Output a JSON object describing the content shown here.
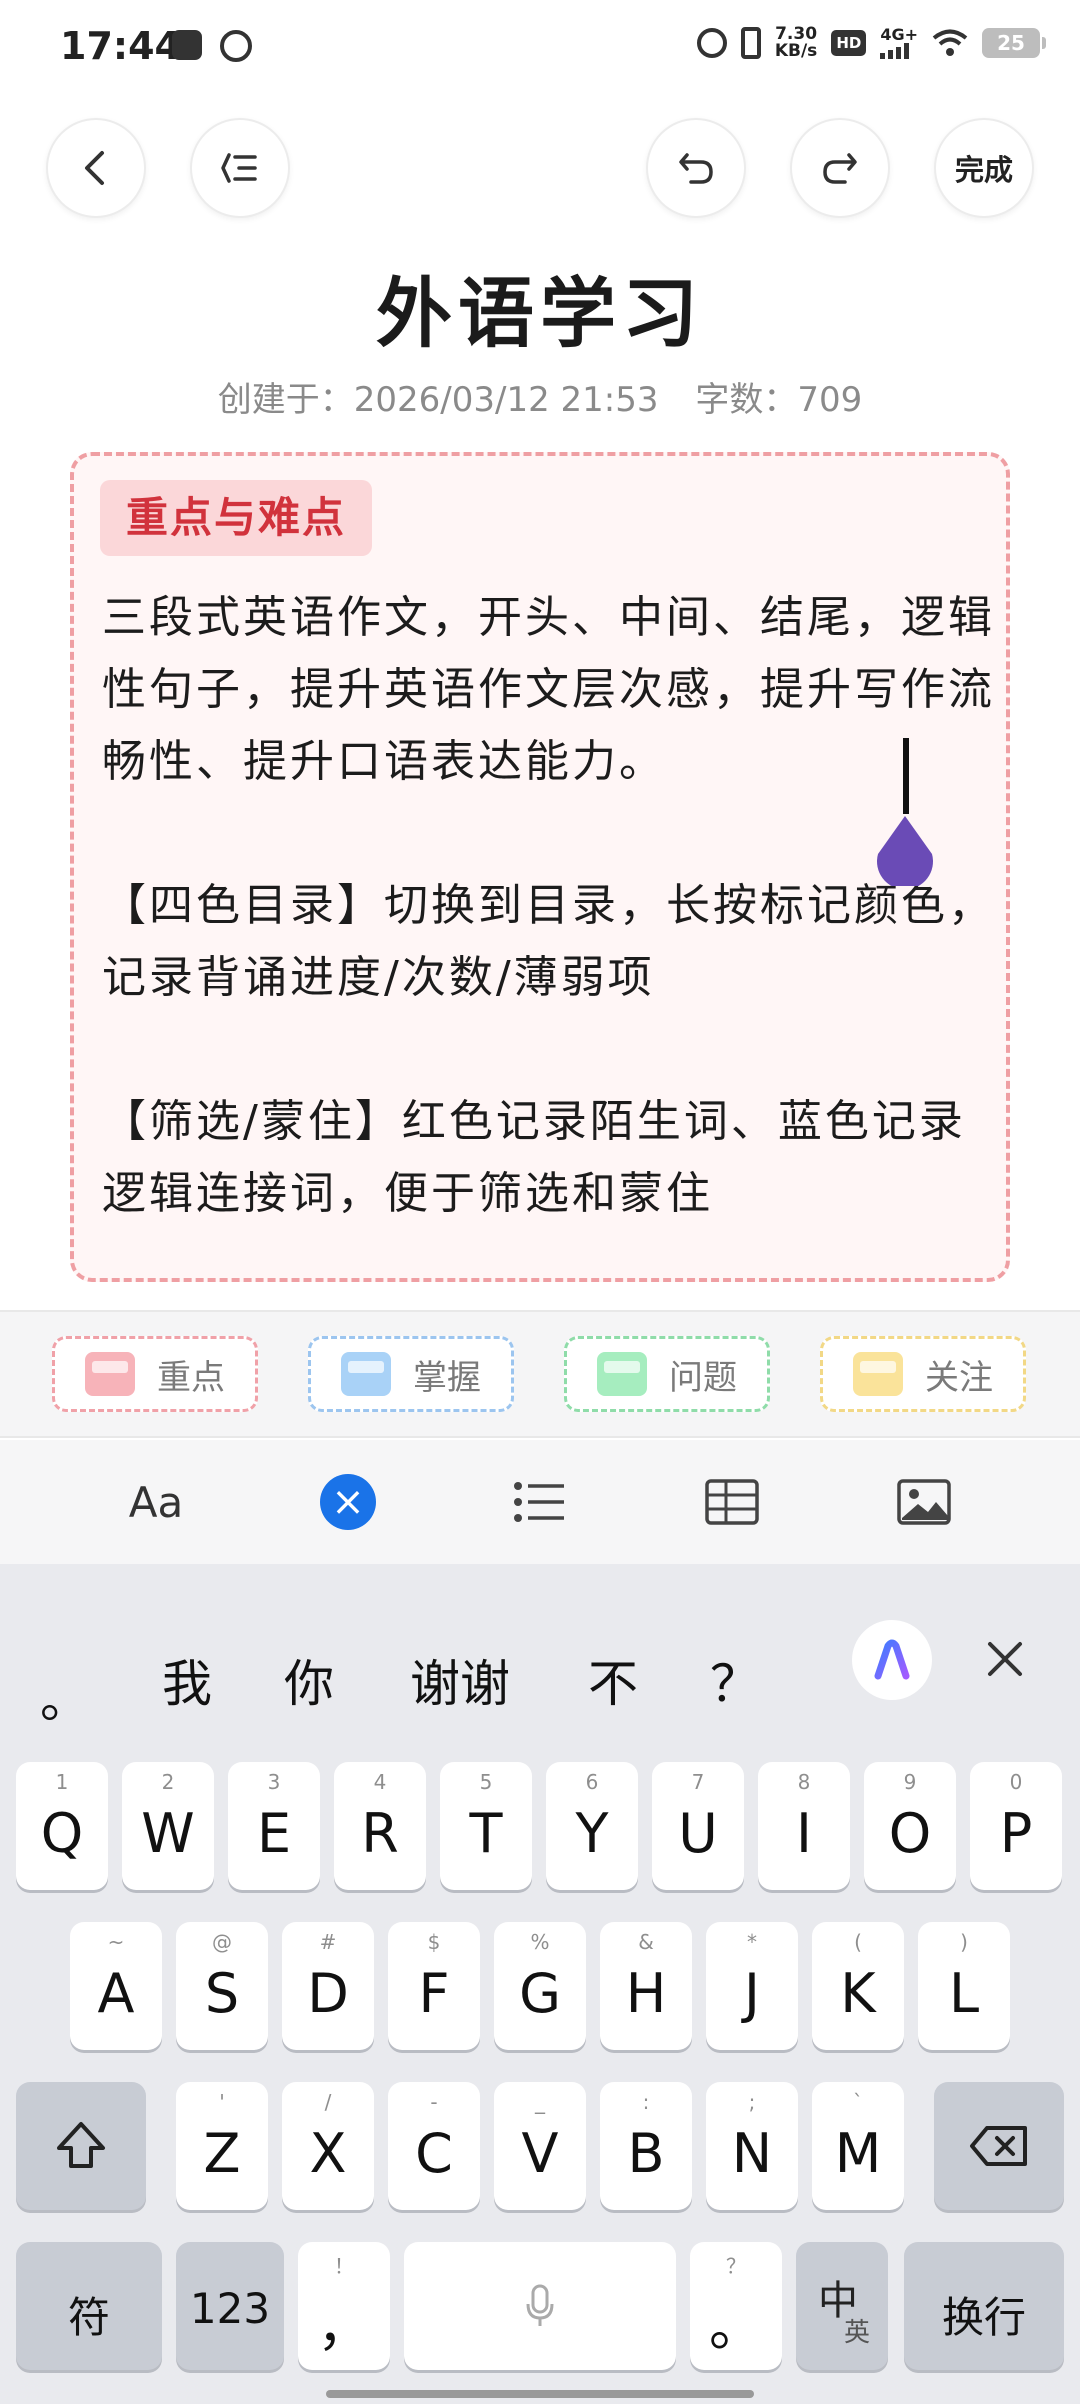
{
  "status_bar": {
    "time": "17:44",
    "net_speed_value": "7.30",
    "net_speed_unit": "KB/s",
    "hd_badge": "HD",
    "network_type": "4G+",
    "battery_level": "25"
  },
  "toolbar": {
    "done_label": "完成"
  },
  "note": {
    "title": "外语学习",
    "created_label": "创建于：",
    "created_value": "2026/03/12 21:53",
    "count_label": "字数：",
    "count_value": "709"
  },
  "card": {
    "tag": "重点与难点",
    "paragraphs": [
      "三段式英语作文，开头、中间、结尾，逻辑性句子，提升英语作文层次感，提升写作流畅性、提升口语表达能力。",
      "【四色目录】切换到目录，长按标记颜色，记录背诵进度/次数/薄弱项",
      "【筛选/蒙住】红色记录陌生词、蓝色记录逻辑连接词，便于筛选和蒙住"
    ],
    "border_color": "#ef9fa3",
    "tag_color": "#d1323c"
  },
  "markers": [
    {
      "label": "重点",
      "color": "#f7b3b9",
      "border": "#f0a1a8"
    },
    {
      "label": "掌握",
      "color": "#a9d2f7",
      "border": "#9cc5ef"
    },
    {
      "label": "问题",
      "color": "#a6edbf",
      "border": "#8fdca9"
    },
    {
      "label": "关注",
      "color": "#fae39a",
      "border": "#f2d886"
    }
  ],
  "format_bar": {
    "font_label": "Aa",
    "close_icon": "×"
  },
  "keyboard": {
    "candidates": [
      "。",
      "我",
      "你",
      "谢谢",
      "不",
      "？"
    ],
    "row1": [
      {
        "main": "Q",
        "sub": "1"
      },
      {
        "main": "W",
        "sub": "2"
      },
      {
        "main": "E",
        "sub": "3"
      },
      {
        "main": "R",
        "sub": "4"
      },
      {
        "main": "T",
        "sub": "5"
      },
      {
        "main": "Y",
        "sub": "6"
      },
      {
        "main": "U",
        "sub": "7"
      },
      {
        "main": "I",
        "sub": "8"
      },
      {
        "main": "O",
        "sub": "9"
      },
      {
        "main": "P",
        "sub": "0"
      }
    ],
    "row2": [
      {
        "main": "A",
        "sub": "~"
      },
      {
        "main": "S",
        "sub": "@"
      },
      {
        "main": "D",
        "sub": "#"
      },
      {
        "main": "F",
        "sub": "$"
      },
      {
        "main": "G",
        "sub": "%"
      },
      {
        "main": "H",
        "sub": "&"
      },
      {
        "main": "J",
        "sub": "*"
      },
      {
        "main": "K",
        "sub": "("
      },
      {
        "main": "L",
        "sub": ")"
      }
    ],
    "row3": [
      {
        "main": "Z",
        "sub": "'"
      },
      {
        "main": "X",
        "sub": "/"
      },
      {
        "main": "C",
        "sub": "-"
      },
      {
        "main": "V",
        "sub": "_"
      },
      {
        "main": "B",
        "sub": ":"
      },
      {
        "main": "N",
        "sub": ";"
      },
      {
        "main": "M",
        "sub": "`"
      }
    ],
    "symbol_label": "符",
    "num_label": "123",
    "comma_main": "，",
    "comma_sub": "！",
    "period_main": "。",
    "period_sub": "？",
    "lang_main": "中",
    "lang_sub": "英",
    "enter_label": "换行"
  }
}
